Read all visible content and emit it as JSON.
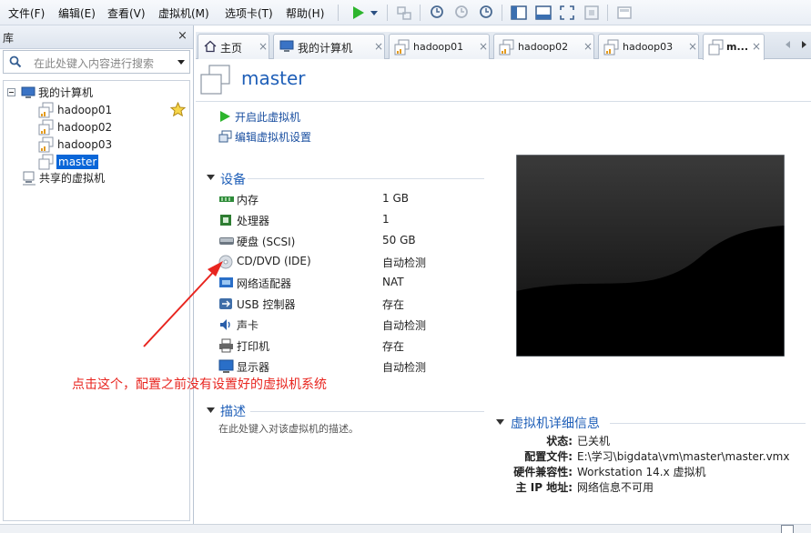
{
  "menu": {
    "file": "文件(F)",
    "edit": "编辑(E)",
    "view": "查看(V)",
    "vm": "虚拟机(M)",
    "tabs": "选项卡(T)",
    "help": "帮助(H)"
  },
  "library": {
    "title": "库",
    "close": "×",
    "search_placeholder": "在此处键入内容进行搜索",
    "tree": {
      "root": "我的计算机",
      "vms": [
        "hadoop01",
        "hadoop02",
        "hadoop03",
        "master"
      ],
      "shared": "共享的虚拟机"
    }
  },
  "tabs": [
    {
      "label": "主页",
      "close": "×"
    },
    {
      "label": "我的计算机",
      "close": "×"
    },
    {
      "label": "hadoop01",
      "close": "×"
    },
    {
      "label": "hadoop02",
      "close": "×"
    },
    {
      "label": "hadoop03",
      "close": "×"
    },
    {
      "label": "m...",
      "close": "×"
    }
  ],
  "vm": {
    "name": "master",
    "actions": {
      "power_on": "开启此虚拟机",
      "edit_settings": "编辑虚拟机设置"
    },
    "devices_title": "设备",
    "devices": [
      {
        "name": "内存",
        "value": "1 GB",
        "icon": "memory-icon"
      },
      {
        "name": "处理器",
        "value": "1",
        "icon": "cpu-icon"
      },
      {
        "name": "硬盘 (SCSI)",
        "value": "50 GB",
        "icon": "hdd-icon"
      },
      {
        "name": "CD/DVD (IDE)",
        "value": "自动检测",
        "icon": "cd-icon"
      },
      {
        "name": "网络适配器",
        "value": "NAT",
        "icon": "network-icon"
      },
      {
        "name": "USB 控制器",
        "value": "存在",
        "icon": "usb-icon"
      },
      {
        "name": "声卡",
        "value": "自动检测",
        "icon": "sound-icon"
      },
      {
        "name": "打印机",
        "value": "存在",
        "icon": "printer-icon"
      },
      {
        "name": "显示器",
        "value": "自动检测",
        "icon": "display-icon"
      }
    ],
    "annotation": "点击这个，配置之前没有设置好的虚拟机系统",
    "description_title": "描述",
    "description_placeholder": "在此处键入对该虚拟机的描述。",
    "details_title": "虚拟机详细信息",
    "details": [
      {
        "label": "状态:",
        "value": "已关机"
      },
      {
        "label": "配置文件:",
        "value": "E:\\学习\\bigdata\\vm\\master\\master.vmx"
      },
      {
        "label": "硬件兼容性:",
        "value": "Workstation 14.x 虚拟机"
      },
      {
        "label": "主 IP 地址:",
        "value": "网络信息不可用"
      }
    ]
  },
  "colors": {
    "accent": "#1f5fb8",
    "annotation": "#e8251f",
    "power": "#2db52d",
    "selection": "#0a66d8"
  }
}
